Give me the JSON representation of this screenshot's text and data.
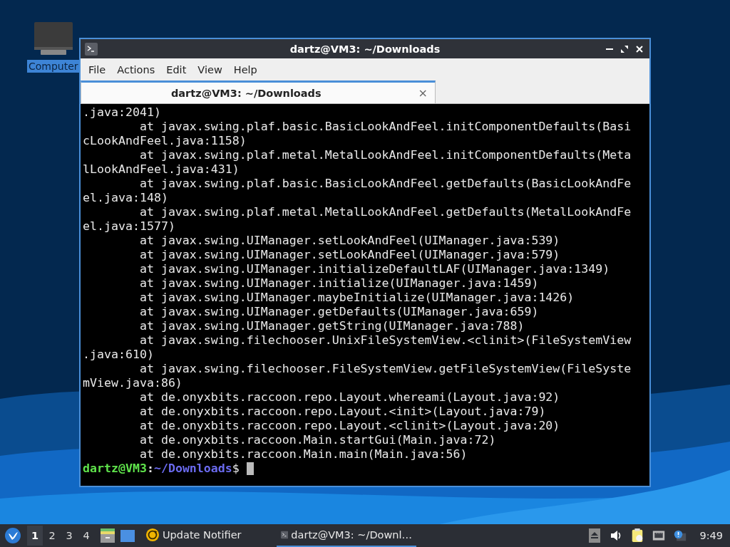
{
  "desktop": {
    "icons": [
      {
        "label": "Computer",
        "selected": true
      }
    ]
  },
  "window": {
    "title": "dartz@VM3: ~/Downloads",
    "menu": [
      "File",
      "Actions",
      "Edit",
      "View",
      "Help"
    ],
    "tabs": [
      {
        "label": "dartz@VM3: ~/Downloads",
        "selected": true,
        "close": "×"
      }
    ],
    "terminal": {
      "lines": [
        ".java:2041)",
        "        at javax.swing.plaf.basic.BasicLookAndFeel.initComponentDefaults(Basi",
        "cLookAndFeel.java:1158)",
        "        at javax.swing.plaf.metal.MetalLookAndFeel.initComponentDefaults(Meta",
        "lLookAndFeel.java:431)",
        "        at javax.swing.plaf.basic.BasicLookAndFeel.getDefaults(BasicLookAndFe",
        "el.java:148)",
        "        at javax.swing.plaf.metal.MetalLookAndFeel.getDefaults(MetalLookAndFe",
        "el.java:1577)",
        "        at javax.swing.UIManager.setLookAndFeel(UIManager.java:539)",
        "        at javax.swing.UIManager.setLookAndFeel(UIManager.java:579)",
        "        at javax.swing.UIManager.initializeDefaultLAF(UIManager.java:1349)",
        "        at javax.swing.UIManager.initialize(UIManager.java:1459)",
        "        at javax.swing.UIManager.maybeInitialize(UIManager.java:1426)",
        "        at javax.swing.UIManager.getDefaults(UIManager.java:659)",
        "        at javax.swing.UIManager.getString(UIManager.java:788)",
        "        at javax.swing.filechooser.UnixFileSystemView.<clinit>(FileSystemView",
        ".java:610)",
        "        at javax.swing.filechooser.FileSystemView.getFileSystemView(FileSyste",
        "mView.java:86)",
        "        at de.onyxbits.raccoon.repo.Layout.whereami(Layout.java:92)",
        "        at de.onyxbits.raccoon.repo.Layout.<init>(Layout.java:79)",
        "        at de.onyxbits.raccoon.repo.Layout.<clinit>(Layout.java:20)",
        "        at de.onyxbits.raccoon.Main.startGui(Main.java:72)",
        "        at de.onyxbits.raccoon.Main.main(Main.java:56)"
      ],
      "prompt": {
        "user": "dartz@VM3",
        "separator": ":",
        "path": "~/Downloads",
        "symbol": "$"
      }
    }
  },
  "taskbar": {
    "workspaces": [
      {
        "label": "1",
        "selected": true
      },
      {
        "label": "2",
        "selected": false
      },
      {
        "label": "3",
        "selected": false
      },
      {
        "label": "4",
        "selected": false
      }
    ],
    "tasks": [
      {
        "kind": "notifier",
        "label": "Update Notifier",
        "selected": false
      },
      {
        "kind": "terminal",
        "label": "dartz@VM3: ~/Downl…",
        "selected": true
      }
    ],
    "clock": "9:49"
  }
}
